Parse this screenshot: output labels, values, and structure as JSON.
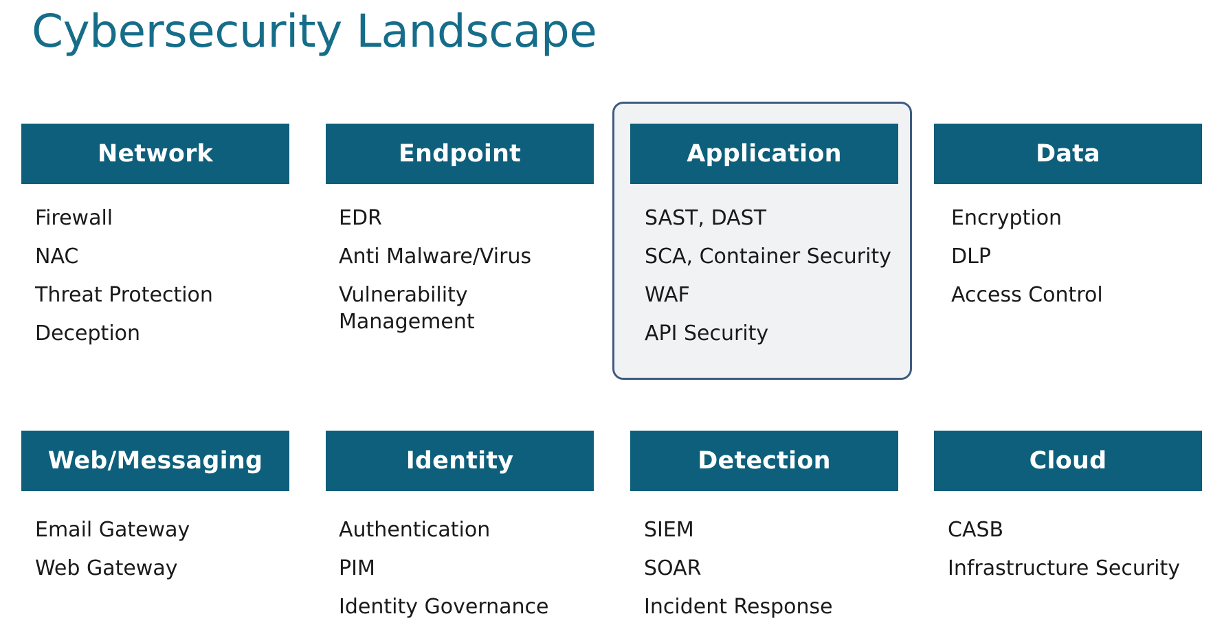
{
  "title": "Cybersecurity Landscape",
  "accent_color": "#0d5f7b",
  "title_color": "#166d8a",
  "highlighted_category": "Application",
  "categories": [
    {
      "name": "Network",
      "items": [
        "Firewall",
        "NAC",
        "Threat Protection",
        "Deception"
      ]
    },
    {
      "name": "Endpoint",
      "items": [
        "EDR",
        "Anti Malware/Virus",
        "Vulnerability Management"
      ]
    },
    {
      "name": "Application",
      "items": [
        "SAST, DAST",
        "SCA, Container Security",
        "WAF",
        "API Security"
      ]
    },
    {
      "name": "Data",
      "items": [
        "Encryption",
        "DLP",
        "Access Control"
      ]
    },
    {
      "name": "Web/Messaging",
      "items": [
        "Email Gateway",
        "Web Gateway"
      ]
    },
    {
      "name": "Identity",
      "items": [
        "Authentication",
        "PIM",
        "Identity Governance"
      ]
    },
    {
      "name": "Detection",
      "items": [
        "SIEM",
        "SOAR",
        "Incident Response"
      ]
    },
    {
      "name": "Cloud",
      "items": [
        "CASB",
        "Infrastructure Security"
      ]
    }
  ]
}
